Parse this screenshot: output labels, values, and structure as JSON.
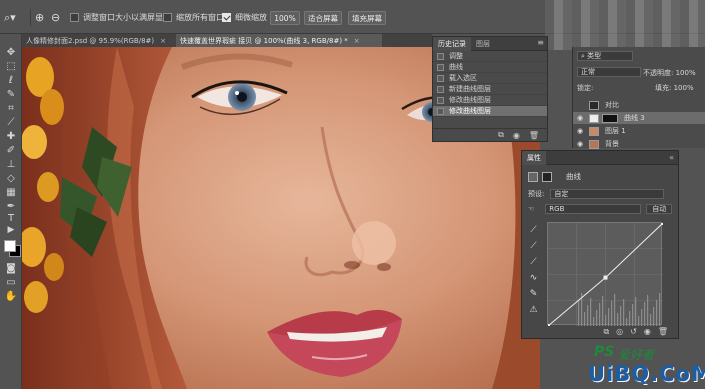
{
  "options": {
    "zoom_tool_icon": "zoom-icon",
    "resize_windows_label": "调整窗口大小以满屏显示",
    "resize_windows_checked": false,
    "zoom_all_windows_label": "缩放所有窗口",
    "zoom_all_windows_checked": false,
    "scrubby_zoom_label": "细微缩放",
    "scrubby_zoom_checked": true,
    "zoom_value": "100%",
    "fit_screen_label": "适合屏幕",
    "fill_screen_label": "填充屏幕"
  },
  "tabs": [
    {
      "label": "人像精修封面2.psd @ 95.9%(RGB/8#)",
      "close": "×"
    },
    {
      "label": "快速覆盖世界瑕疵 接贝 @ 100%(曲线 3, RGB/8#) *",
      "close": "×"
    }
  ],
  "history": {
    "tabs": [
      "历史记录",
      "图层"
    ],
    "items": [
      "调整",
      "曲线",
      "载入选区",
      "新建曲线图层",
      "修改曲线图层",
      "修改曲线图层"
    ],
    "selected_index": 5
  },
  "layers": {
    "kind_filter": "类型",
    "blend_mode": "正常",
    "opacity_label": "不透明度:",
    "opacity_value": "100%",
    "lock_label": "锁定:",
    "fill_label": "填充:",
    "fill_value": "100%",
    "rows": [
      {
        "name": "对比",
        "visible": false,
        "selected": false
      },
      {
        "name": "曲线 3",
        "visible": true,
        "selected": true
      },
      {
        "name": "图层 1",
        "visible": true,
        "selected": false
      },
      {
        "name": "背景",
        "visible": true,
        "selected": false
      }
    ]
  },
  "properties": {
    "title": "属性",
    "panel_name": "曲线",
    "preset_label": "预设:",
    "preset_value": "自定",
    "channel_value": "RGB",
    "auto_label": "自动",
    "curve_points": [
      [
        0,
        0
      ],
      [
        0.5,
        0.47
      ],
      [
        1,
        1
      ]
    ]
  },
  "watermark": {
    "ps_text": "PS",
    "cn_text": "爱好者",
    "site_text": "UiBQ.CoM"
  },
  "colors": {
    "accent": "#6c6c6c",
    "watermark_green": "#1e8a3a",
    "watermark_blue": "#1b5ea8"
  }
}
